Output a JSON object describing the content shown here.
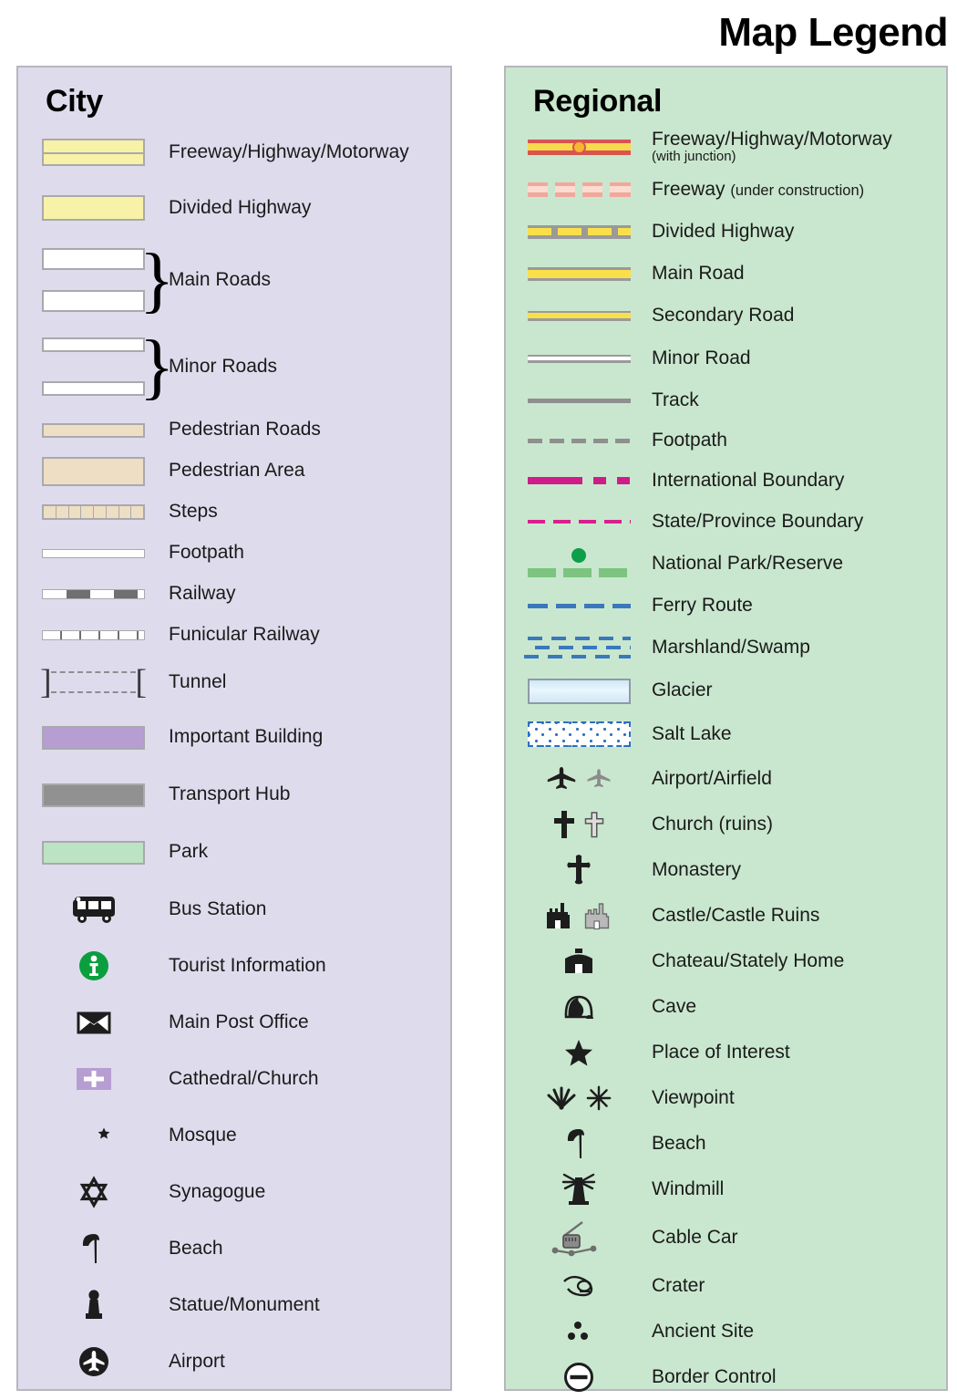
{
  "title": "Map Legend",
  "city": {
    "heading": "City",
    "items": [
      {
        "label": "Freeway/Highway/Motorway",
        "symbol": "city-freeway"
      },
      {
        "label": "Divided Highway",
        "symbol": "city-divided-highway"
      },
      {
        "label": "Main Roads",
        "symbol": "city-main-roads-braced"
      },
      {
        "label": "Minor Roads",
        "symbol": "city-minor-roads-braced"
      },
      {
        "label": "Pedestrian Roads",
        "symbol": "city-pedestrian-road"
      },
      {
        "label": "Pedestrian Area",
        "symbol": "city-pedestrian-area"
      },
      {
        "label": "Steps",
        "symbol": "city-steps"
      },
      {
        "label": "Footpath",
        "symbol": "city-footpath"
      },
      {
        "label": "Railway",
        "symbol": "city-railway"
      },
      {
        "label": "Funicular Railway",
        "symbol": "city-funicular-railway"
      },
      {
        "label": "Tunnel",
        "symbol": "city-tunnel"
      },
      {
        "label": "Important Building",
        "symbol": "city-important-building"
      },
      {
        "label": "Transport Hub",
        "symbol": "city-transport-hub"
      },
      {
        "label": "Park",
        "symbol": "city-park"
      },
      {
        "label": "Bus Station",
        "symbol": "bus-icon"
      },
      {
        "label": "Tourist Information",
        "symbol": "information-icon"
      },
      {
        "label": "Main Post Office",
        "symbol": "envelope-icon"
      },
      {
        "label": "Cathedral/Church",
        "symbol": "church-cross-icon"
      },
      {
        "label": "Mosque",
        "symbol": "crescent-star-icon"
      },
      {
        "label": "Synagogue",
        "symbol": "star-of-david-icon"
      },
      {
        "label": "Beach",
        "symbol": "beach-umbrella-icon"
      },
      {
        "label": "Statue/Monument",
        "symbol": "statue-icon"
      },
      {
        "label": "Airport",
        "symbol": "airport-circle-icon"
      }
    ]
  },
  "regional": {
    "heading": "Regional",
    "items": [
      {
        "label": "Freeway/Highway/Motorway",
        "sublabel": "(with junction)",
        "symbol": "regional-freeway-junction"
      },
      {
        "label": "Freeway",
        "inline_note": "(under construction)",
        "symbol": "regional-freeway-under-construction"
      },
      {
        "label": "Divided Highway",
        "symbol": "regional-divided-highway"
      },
      {
        "label": "Main Road",
        "symbol": "regional-main-road"
      },
      {
        "label": "Secondary Road",
        "symbol": "regional-secondary-road"
      },
      {
        "label": "Minor Road",
        "symbol": "regional-minor-road"
      },
      {
        "label": "Track",
        "symbol": "regional-track"
      },
      {
        "label": "Footpath",
        "symbol": "regional-footpath"
      },
      {
        "label": "International Boundary",
        "symbol": "regional-international-boundary"
      },
      {
        "label": "State/Province Boundary",
        "symbol": "regional-state-boundary"
      },
      {
        "label": "National Park/Reserve",
        "symbol": "regional-national-park"
      },
      {
        "label": "Ferry Route",
        "symbol": "regional-ferry-route"
      },
      {
        "label": "Marshland/Swamp",
        "symbol": "regional-marshland"
      },
      {
        "label": "Glacier",
        "symbol": "regional-glacier"
      },
      {
        "label": "Salt Lake",
        "symbol": "regional-salt-lake"
      },
      {
        "label": "Airport/Airfield",
        "symbol": "airplane-pair-icon"
      },
      {
        "label": "Church (ruins)",
        "symbol": "cross-pair-icon"
      },
      {
        "label": "Monastery",
        "symbol": "monastery-cross-icon"
      },
      {
        "label": "Castle/Castle Ruins",
        "symbol": "castle-pair-icon"
      },
      {
        "label": "Chateau/Stately Home",
        "symbol": "chateau-icon"
      },
      {
        "label": "Cave",
        "symbol": "cave-icon"
      },
      {
        "label": "Place of Interest",
        "symbol": "star-icon"
      },
      {
        "label": "Viewpoint",
        "symbol": "viewpoint-pair-icon"
      },
      {
        "label": "Beach",
        "symbol": "beach-umbrella-icon"
      },
      {
        "label": "Windmill",
        "symbol": "windmill-icon"
      },
      {
        "label": "Cable Car",
        "symbol": "cable-car-icon"
      },
      {
        "label": "Crater",
        "symbol": "crater-icon"
      },
      {
        "label": "Ancient Site",
        "symbol": "ancient-site-icon"
      },
      {
        "label": "Border Control",
        "symbol": "border-control-icon"
      }
    ]
  },
  "colors": {
    "city_panel_bg": "#dedcec",
    "regional_panel_bg": "#c9e7ce",
    "panel_border": "#b6b6bd",
    "highway_yellow": "#f8f1a8",
    "road_yellow": "#f9e04a",
    "freeway_red": "#d9544e",
    "junction_orange": "#f5b731",
    "pedestrian_tan": "#eedfc4",
    "important_building_purple": "#b69ed2",
    "transport_hub_gray": "#919191",
    "park_green": "#bce3c4",
    "boundary_magenta": "#cf1c8b",
    "park_dash_green": "#7cc47f",
    "park_dot_green": "#0d9e49",
    "ferry_blue": "#3a78bd",
    "tourist_info_green": "#0a9e3f",
    "glacier_blue": "#cfe7f7",
    "road_gray": "#9a9a9a"
  }
}
